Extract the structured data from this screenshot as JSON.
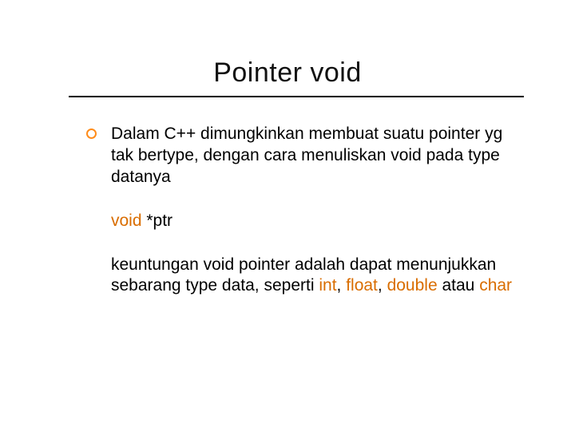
{
  "title": "Pointer void",
  "body": {
    "p1": "Dalam C++ dimungkinkan membuat suatu pointer yg tak bertype, dengan cara menuliskan void pada type datanya",
    "code_kw": "void",
    "code_rest": " *ptr",
    "p3_a": "keuntungan void pointer adalah dapat menunjukkan sebarang type data, seperti ",
    "p3_int": "int",
    "p3_sep1": ", ",
    "p3_float": "float",
    "p3_sep2": ", ",
    "p3_double": "double",
    "p3_mid": " atau ",
    "p3_char": "char"
  }
}
